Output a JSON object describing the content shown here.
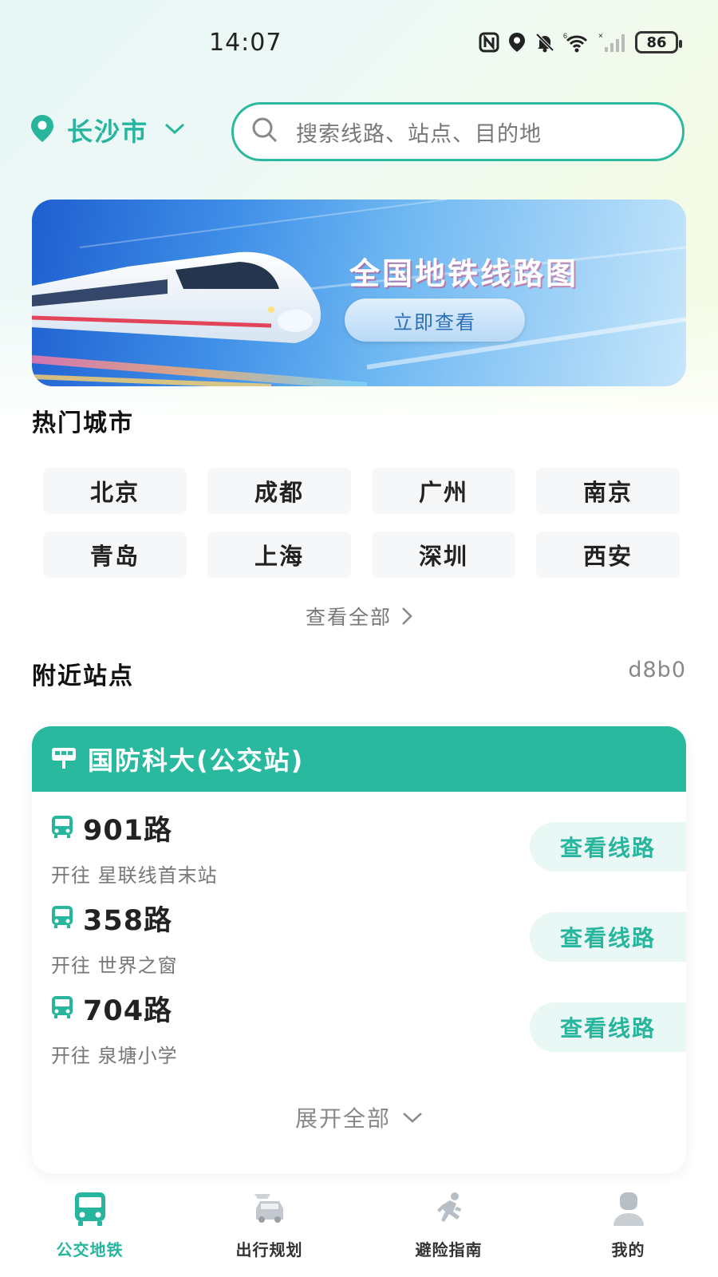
{
  "status_bar": {
    "time": "14:07",
    "battery": "86",
    "icons": [
      "nfc-icon",
      "location-icon",
      "mute-bell-icon",
      "wifi-icon",
      "signal-icon",
      "battery-icon"
    ]
  },
  "header": {
    "city": "长沙市",
    "search_placeholder": "搜索线路、站点、目的地"
  },
  "banner": {
    "title": "全国地铁线路图",
    "button": "立即查看"
  },
  "hot_cities": {
    "title": "热门城市",
    "cities": [
      "北京",
      "成都",
      "广州",
      "南京",
      "青岛",
      "上海",
      "深圳",
      "西安"
    ],
    "view_all": "查看全部"
  },
  "nearby": {
    "title": "附近站点",
    "code": "d8b0",
    "station": {
      "name": "国防科大(公交站)",
      "routes": [
        {
          "number": "901路",
          "destination": "开往 星联线首末站",
          "button": "查看线路"
        },
        {
          "number": "358路",
          "destination": "开往 世界之窗",
          "button": "查看线路"
        },
        {
          "number": "704路",
          "destination": "开往 泉塘小学",
          "button": "查看线路"
        }
      ],
      "expand": "展开全部"
    }
  },
  "bottom_nav": {
    "items": [
      {
        "label": "公交地铁",
        "icon": "bus-icon",
        "active": true
      },
      {
        "label": "出行规划",
        "icon": "car-icon",
        "active": false
      },
      {
        "label": "避险指南",
        "icon": "running-person-icon",
        "active": false
      },
      {
        "label": "我的",
        "icon": "user-icon",
        "active": false
      }
    ]
  },
  "colors": {
    "accent": "#27b59e",
    "text": "#222222",
    "muted": "#777777",
    "tile_bg": "#f6f7f8"
  }
}
